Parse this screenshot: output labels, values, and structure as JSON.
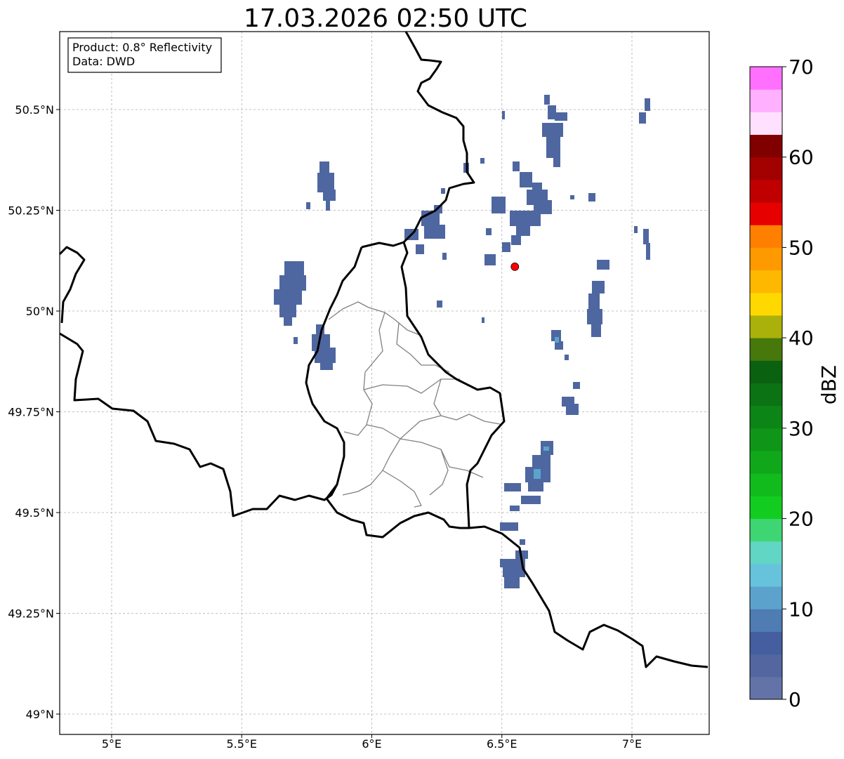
{
  "title": "17.03.2026 02:50 UTC",
  "info_box": {
    "product_line": "Product: 0.8° Reflectivity",
    "data_line": "Data: DWD"
  },
  "map": {
    "lon_range": [
      4.8,
      7.3
    ],
    "lat_range": [
      48.95,
      50.7
    ],
    "x_ticks": [
      {
        "value": 5.0,
        "label": "5°E"
      },
      {
        "value": 5.5,
        "label": "5.5°E"
      },
      {
        "value": 6.0,
        "label": "6°E"
      },
      {
        "value": 6.5,
        "label": "6.5°E"
      },
      {
        "value": 7.0,
        "label": "7°E"
      }
    ],
    "y_ticks": [
      {
        "value": 49.0,
        "label": "49°N"
      },
      {
        "value": 49.25,
        "label": "49.25°N"
      },
      {
        "value": 49.5,
        "label": "49.5°N"
      },
      {
        "value": 49.75,
        "label": "49.75°N"
      },
      {
        "value": 50.0,
        "label": "50°N"
      },
      {
        "value": 50.25,
        "label": "50.25°N"
      },
      {
        "value": 50.5,
        "label": "50.5°N"
      }
    ],
    "grid": true,
    "radar_site": {
      "lon": 6.55,
      "lat": 50.11,
      "color": "#ff0000"
    },
    "echo_color": "#4f67a0",
    "echo_highlight_color": "#5ba3cc"
  },
  "colorbar": {
    "label": "dBZ",
    "min": 0,
    "max": 70,
    "step": 2.5,
    "tick_values": [
      0,
      10,
      20,
      30,
      40,
      50,
      60,
      70
    ],
    "tick_labels": [
      "0",
      "10",
      "20",
      "30",
      "40",
      "50",
      "60",
      "70"
    ],
    "colors": [
      "#6373a8",
      "#5366a0",
      "#445ea0",
      "#4e7cb3",
      "#5ba3cc",
      "#67c3dc",
      "#62d6c4",
      "#3ed672",
      "#13cc20",
      "#11bb1c",
      "#10a81a",
      "#0f9618",
      "#0d8516",
      "#0b7314",
      "#0a6110",
      "#46780b",
      "#aab10a",
      "#ffd800",
      "#ffb800",
      "#ff9900",
      "#ff7f00",
      "#e60000",
      "#c00000",
      "#a30000",
      "#800000",
      "#ffe0ff",
      "#ffb0ff",
      "#ff70ff",
      "#ee33ee"
    ]
  }
}
